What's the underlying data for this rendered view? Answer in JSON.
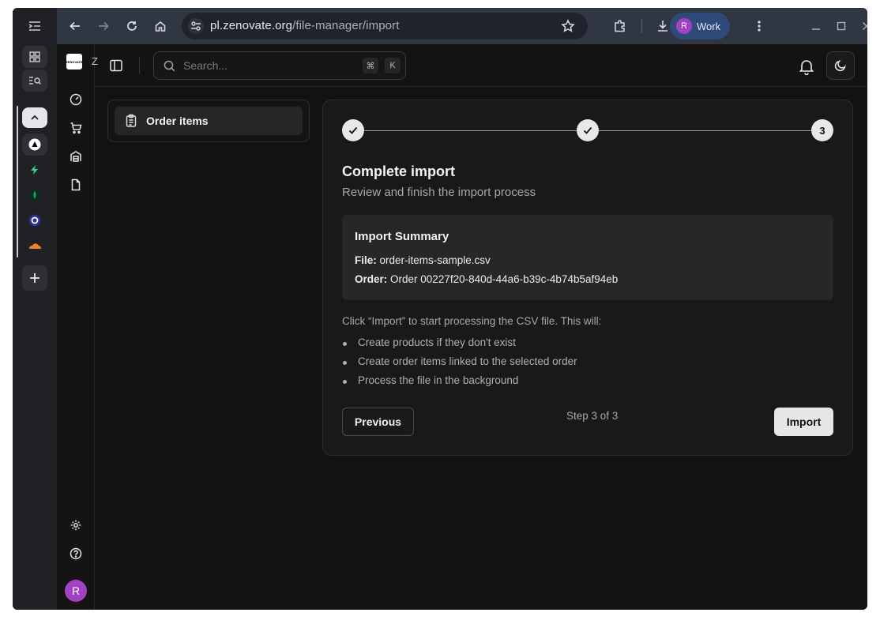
{
  "browser": {
    "url_host": "pl.zenovate.org",
    "url_path": "/file-manager/import",
    "profile_initial": "R",
    "profile_label": "Work",
    "icons": [
      "sidebar-toggle-icon",
      "back-icon",
      "forward-icon",
      "reload-icon",
      "home-icon",
      "site-settings-icon",
      "bookmark-star-icon",
      "extensions-icon",
      "download-icon",
      "more-icon",
      "minimize-icon",
      "maximize-icon",
      "close-icon"
    ]
  },
  "app": {
    "logo_text": "ZENOVATE",
    "brand_initial": "Z",
    "search_placeholder": "Search...",
    "shortcut_mod": "⌘",
    "shortcut_key": "K",
    "user_initial": "R"
  },
  "panel": {
    "item_label": "Order items"
  },
  "wizard": {
    "steps": [
      "done",
      "done",
      "3"
    ],
    "title": "Complete import",
    "subtitle": "Review and finish the import process",
    "summary": {
      "title": "Import Summary",
      "file_label": "File:",
      "file_value": "order-items-sample.csv",
      "order_label": "Order:",
      "order_value": "Order 00227f20-840d-44a6-b39c-4b74b5af94eb"
    },
    "instruction": "Click “Import” to start processing the CSV file. This will:",
    "bullets": [
      "Create products if they don't exist",
      "Create order items linked to the selected order",
      "Process the file in the background"
    ],
    "previous_label": "Previous",
    "step_text": "Step 3 of 3",
    "import_label": "Import"
  }
}
